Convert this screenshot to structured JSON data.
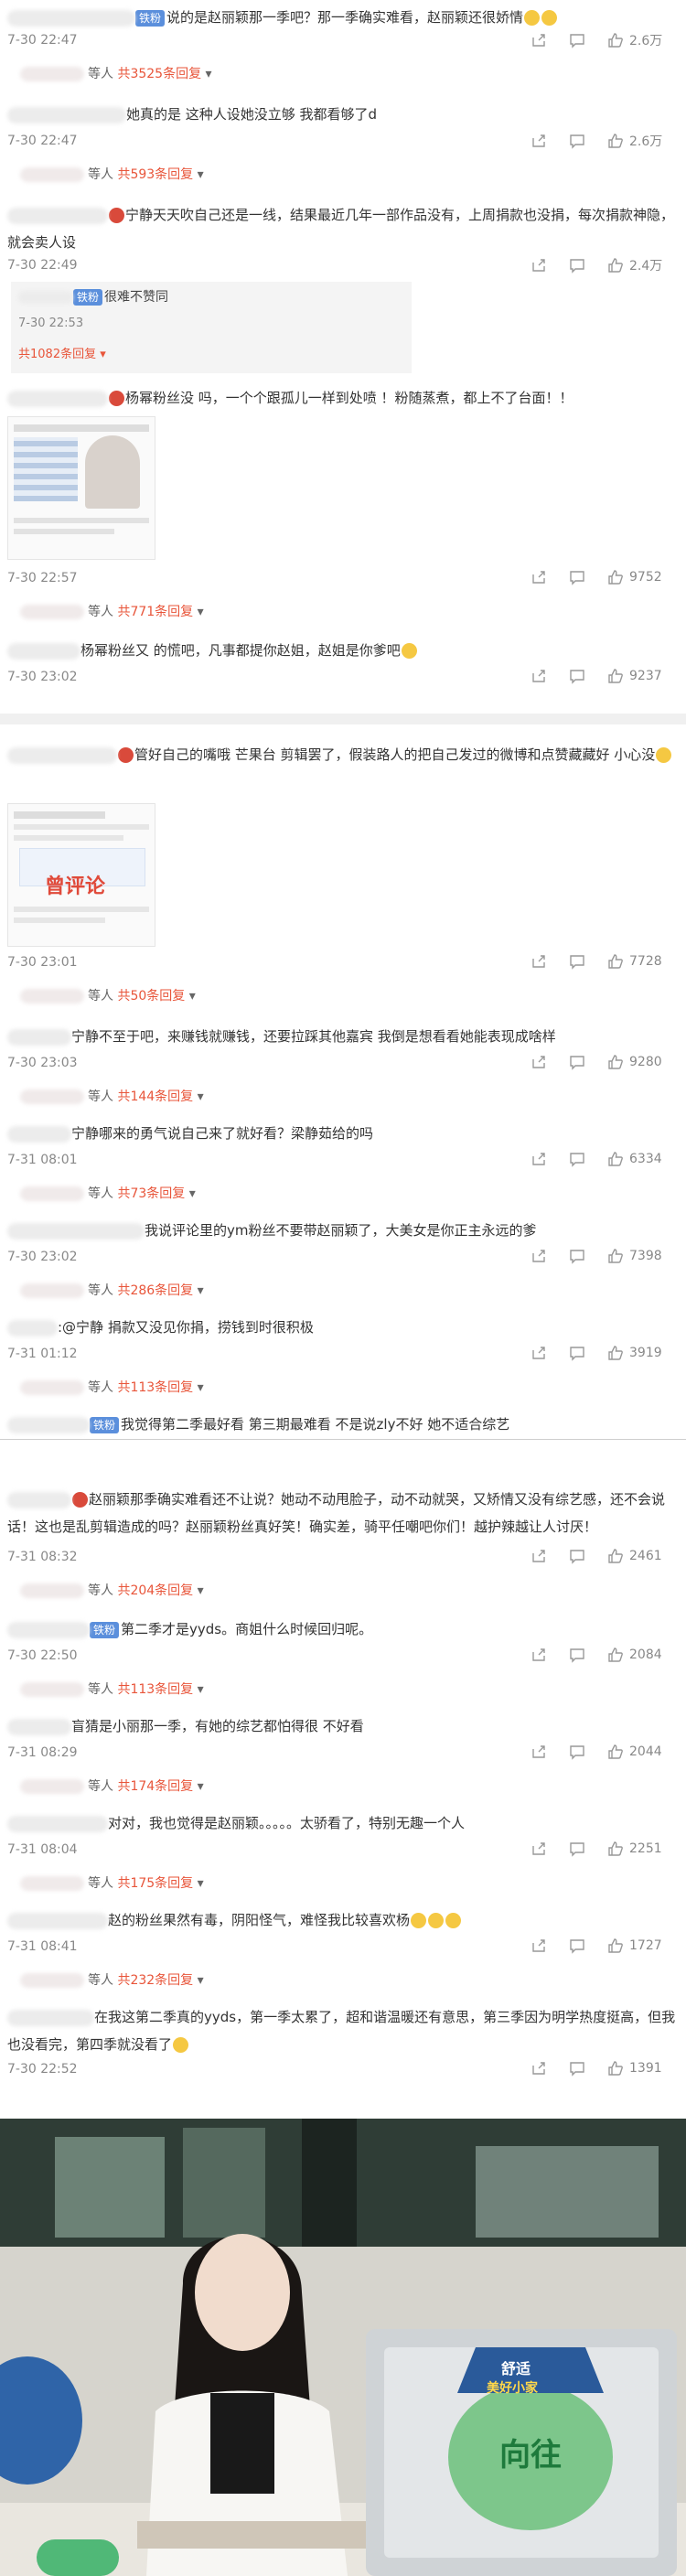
{
  "comments": [
    {
      "prefix": "",
      "tag": "",
      "text": "说的是赵丽颖那一季吧？那一季确实难看，赵丽颖还很娇情",
      "date": "7-30 22:47",
      "likes": "2.6万"
    },
    {
      "prefix": "",
      "tag": "",
      "text": "她真的是 这种人设她没立够 我都看够了d",
      "date": "7-30 22:47",
      "likes": "2.6万"
    },
    {
      "prefix": "",
      "tag": "",
      "text": "宁静天天吹自己还是一线，结果最近几年一部作品没有，上周捐款也没捐，每次捐款神隐，就会卖人设",
      "date": "7-30 22:49",
      "likes": "2.4万"
    },
    {
      "prefix": "",
      "tag": "",
      "text": "杨幂粉丝没 吗，一个个跟孤儿一样到处喷 ！粉随蒸煮，都上不了台面！！",
      "date": "7-30 22:57",
      "likes": "9752"
    },
    {
      "prefix": "",
      "tag": "",
      "text": "杨幂粉丝又 的慌吧，凡事都提你赵姐，赵姐是你爹吧",
      "date": "7-30 23:02",
      "likes": "9237"
    },
    {
      "prefix": "",
      "tag": "",
      "text": "管好自己的嘴哦 芒果台 剪辑罢了，假装路人的把自己发过的微博和点赞藏藏好 小心没",
      "date": "7-30 23:01",
      "likes": "7728"
    },
    {
      "prefix": "",
      "tag": "",
      "text": "宁静不至于吧，来赚钱就赚钱，还要拉踩其他嘉宾 我倒是想看看她能表现成啥样",
      "date": "7-30 23:03",
      "likes": "9280"
    },
    {
      "prefix": "",
      "tag": "",
      "text": "宁静哪来的勇气说自己来了就好看？梁静茹给的吗",
      "date": "7-31 08:01",
      "likes": "6334"
    },
    {
      "prefix": "",
      "tag": "",
      "text": "我说评论里的ym粉丝不要带赵丽颖了，大美女是你正主永远的爹",
      "date": "7-30 23:02",
      "likes": "7398"
    },
    {
      "prefix": "",
      "tag": "",
      "text": ":@宁静 捐款又没见你捐，捞钱到时很积极",
      "date": "7-31 01:12",
      "likes": "3919"
    },
    {
      "prefix": "",
      "tag": "",
      "text": "赵丽颖那季确实难看还不让说？她动不动甩脸子，动不动就哭，又矫情又没有综艺感，还不会说话！这也是乱剪辑造成的吗？赵丽颖粉丝真好笑！确实差，骑平任嘲吧你们！越护辣越让人讨厌！",
      "date": "7-31 08:32",
      "likes": "2461"
    },
    {
      "prefix": "",
      "tag": "",
      "text": "第二季才是yyds。商姐什么时候回归呢。",
      "date": "7-30 22:50",
      "likes": "2084"
    },
    {
      "prefix": "",
      "tag": "",
      "text": "盲猜是小丽那一季，有她的综艺都怕得很 不好看",
      "date": "7-31 08:29",
      "likes": "2044"
    },
    {
      "prefix": "",
      "tag": "",
      "text": "对对，我也觉得是赵丽颖。。。。。太骄看了，特别无趣一个人",
      "date": "7-31 08:04",
      "likes": "2251"
    },
    {
      "prefix": "",
      "tag": "",
      "text": "赵的粉丝果然有毒，阴阳怪气，难怪我比较喜欢杨",
      "date": "7-31 08:41",
      "likes": "1727"
    },
    {
      "prefix": "",
      "tag": "",
      "text": "在我这第二季真的yyds，第一季太累了，超和谐温暖还有意思，第三季因为明学热度挺高，但我也没看完，第四季就没看了",
      "date": "7-30 22:52",
      "likes": "1391"
    }
  ],
  "replies": [
    {
      "suffix": "等人 ",
      "count": "共3525条回复"
    },
    {
      "suffix": "等人 ",
      "count": "共593条回复"
    },
    {
      "suffix": "",
      "count": "共1082条回复"
    },
    {
      "suffix": "等人 ",
      "count": "共771条回复"
    },
    {
      "suffix": "等人 ",
      "count": "共50条回复"
    },
    {
      "suffix": "等人 ",
      "count": "共144条回复"
    },
    {
      "suffix": "等人 ",
      "count": "共73条回复"
    },
    {
      "suffix": "等人 ",
      "count": "共286条回复"
    },
    {
      "suffix": "等人 ",
      "count": "共113条回复"
    },
    {
      "suffix": "等人 ",
      "count": "共204条回复"
    },
    {
      "suffix": "等人 ",
      "count": "共113条回复"
    },
    {
      "suffix": "等人 ",
      "count": "共174条回复"
    },
    {
      "suffix": "等人 ",
      "count": "共175条回复"
    },
    {
      "suffix": "等人 ",
      "count": "共232条回复"
    }
  ],
  "subreply": {
    "tag": "铁粉",
    "text": "很难不赞同",
    "date": "7-30 22:53"
  },
  "tags": {
    "fan": "铁粉"
  },
  "separator_line": {
    "text": "我觉得第二季最好看 第三期最难看 不是说zly不好 她不适合综艺"
  },
  "thumb2_overlay": "曾评论",
  "photo": {
    "badge_top": "舒适",
    "badge_mid": "美好小家",
    "badge_bottom": "向往"
  },
  "colors": {
    "accent_reply": "#e8553a",
    "tag_bg": "#5b8fdc",
    "meta": "#888888"
  }
}
